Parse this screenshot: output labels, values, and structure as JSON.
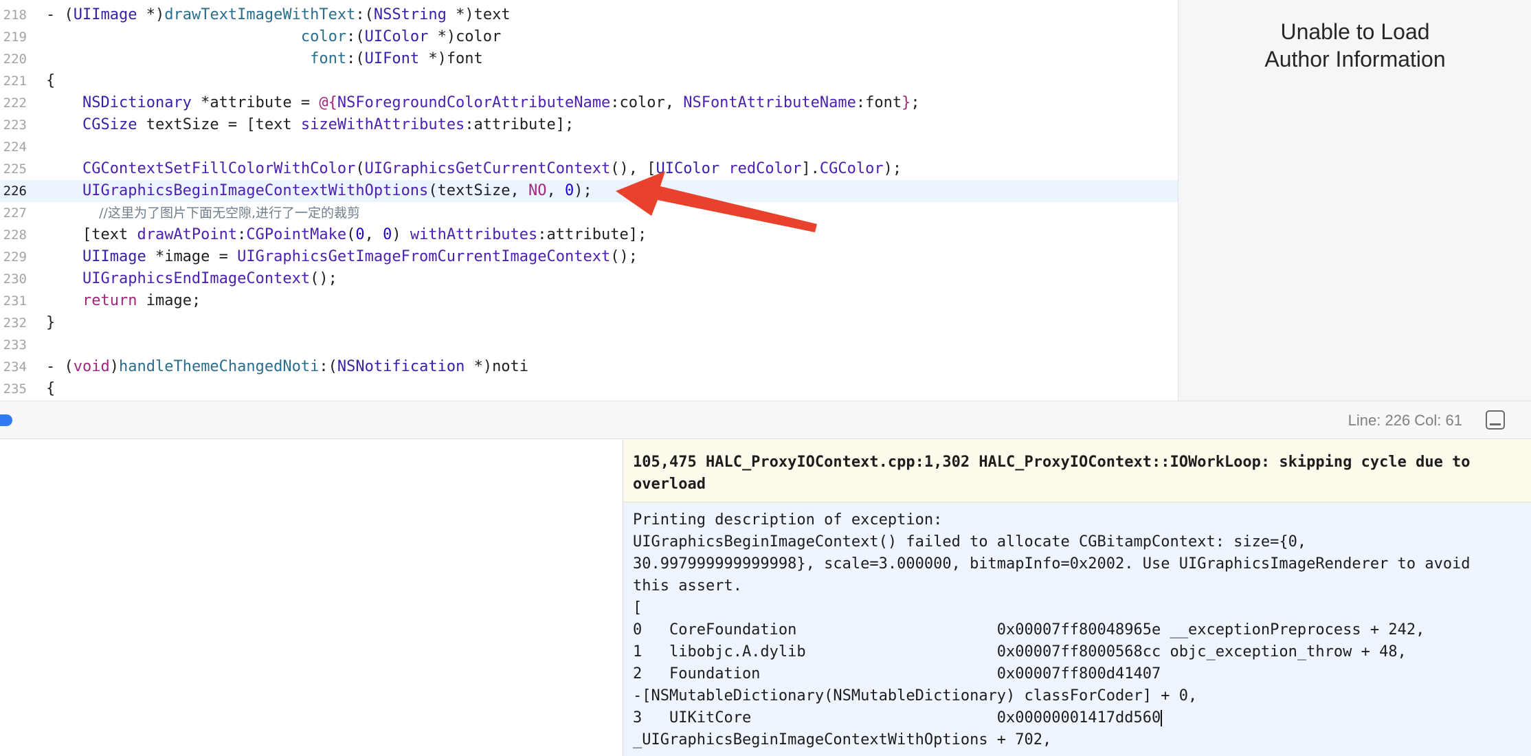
{
  "editor": {
    "current_line": "226",
    "lines": [
      {
        "num": "218",
        "text": "- (UIImage *)drawTextImageWithText:(NSString *)text"
      },
      {
        "num": "219",
        "text": "                            color:(UIColor *)color"
      },
      {
        "num": "220",
        "text": "                             font:(UIFont *)font"
      },
      {
        "num": "221",
        "text": "{"
      },
      {
        "num": "222",
        "text": "    NSDictionary *attribute = @{NSForegroundColorAttributeName:color, NSFontAttributeName:font};"
      },
      {
        "num": "223",
        "text": "    CGSize textSize = [text sizeWithAttributes:attribute];"
      },
      {
        "num": "224",
        "text": ""
      },
      {
        "num": "225",
        "text": "    CGContextSetFillColorWithColor(UIGraphicsGetCurrentContext(), [UIColor redColor].CGColor);"
      },
      {
        "num": "226",
        "text": "    UIGraphicsBeginImageContextWithOptions(textSize, NO, 0);"
      },
      {
        "num": "227",
        "text": "    //这里为了图片下面无空隙,进行了一定的裁剪"
      },
      {
        "num": "228",
        "text": "    [text drawAtPoint:CGPointMake(0, 0) withAttributes:attribute];"
      },
      {
        "num": "229",
        "text": "    UIImage *image = UIGraphicsGetImageFromCurrentImageContext();"
      },
      {
        "num": "230",
        "text": "    UIGraphicsEndImageContext();"
      },
      {
        "num": "231",
        "text": "    return image;"
      },
      {
        "num": "232",
        "text": "}"
      },
      {
        "num": "233",
        "text": ""
      },
      {
        "num": "234",
        "text": "- (void)handleThemeChangedNoti:(NSNotification *)noti"
      },
      {
        "num": "235",
        "text": "{"
      }
    ]
  },
  "author_pane": {
    "line1": "Unable to Load",
    "line2": "Author Information"
  },
  "status_bar": {
    "line_col": "Line: 226  Col: 61"
  },
  "console": {
    "warning": "105,475 HALC_ProxyIOContext.cpp:1,302 HALC_ProxyIOContext::IOWorkLoop: skipping cycle due to overload",
    "lines": [
      "Printing description of exception:",
      "UIGraphicsBeginImageContext() failed to allocate CGBitampContext: size={0,",
      "30.997999999999998}, scale=3.000000, bitmapInfo=0x2002. Use UIGraphicsImageRenderer to avoid",
      "this assert.",
      "[",
      "0   CoreFoundation                      0x00007ff80048965e __exceptionPreprocess + 242,",
      "1   libobjc.A.dylib                     0x00007ff8000568cc objc_exception_throw + 48,",
      "2   Foundation                          0x00007ff800d41407",
      "-[NSMutableDictionary(NSMutableDictionary) classForCoder] + 0,",
      "3   UIKitCore                           0x00000001417dd560",
      "_UIGraphicsBeginImageContextWithOptions + 702,"
    ]
  },
  "colors": {
    "annotation_arrow": "#e8412c",
    "current_line_bg": "#ecf5ff",
    "console_bg": "#eef5ff",
    "warning_bg": "#fefbed",
    "accent_blue": "#2f7af6"
  }
}
